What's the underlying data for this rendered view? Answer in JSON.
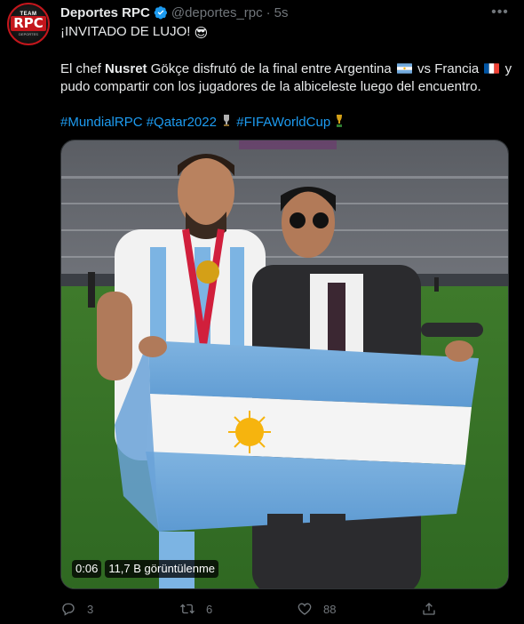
{
  "tweet": {
    "author_name": "Deportes RPC",
    "handle": "@deportes_rpc",
    "separator": "·",
    "time": "5s",
    "more_label": "•••",
    "avatar": {
      "top_text": "TEAM",
      "main_text": "RPC",
      "bottom_text": "DEPORTES"
    },
    "text": {
      "line1": "¡INVITADO DE LUJO!",
      "line1_emoji": "😎",
      "p2_a": "El chef ",
      "p2_bold": "Nusret",
      "p2_b": " Gökçe disfrutó de la final entre Argentina",
      "p2_c": " vs Francia",
      "p2_d": " y pudo compartir con los jugadores de la albiceleste luego del encuentro.",
      "hashtags": [
        "#MundialRPC",
        "#Qatar2022",
        "#FIFAWorldCup"
      ]
    },
    "media": {
      "duration": "0:06",
      "views": "11,7 B görüntülenme"
    },
    "actions": {
      "replies": "3",
      "retweets": "6",
      "likes": "88"
    },
    "colors": {
      "accent": "#1d9bf0",
      "muted": "#71767b",
      "text": "#e7e9ea",
      "background": "#000000"
    }
  }
}
